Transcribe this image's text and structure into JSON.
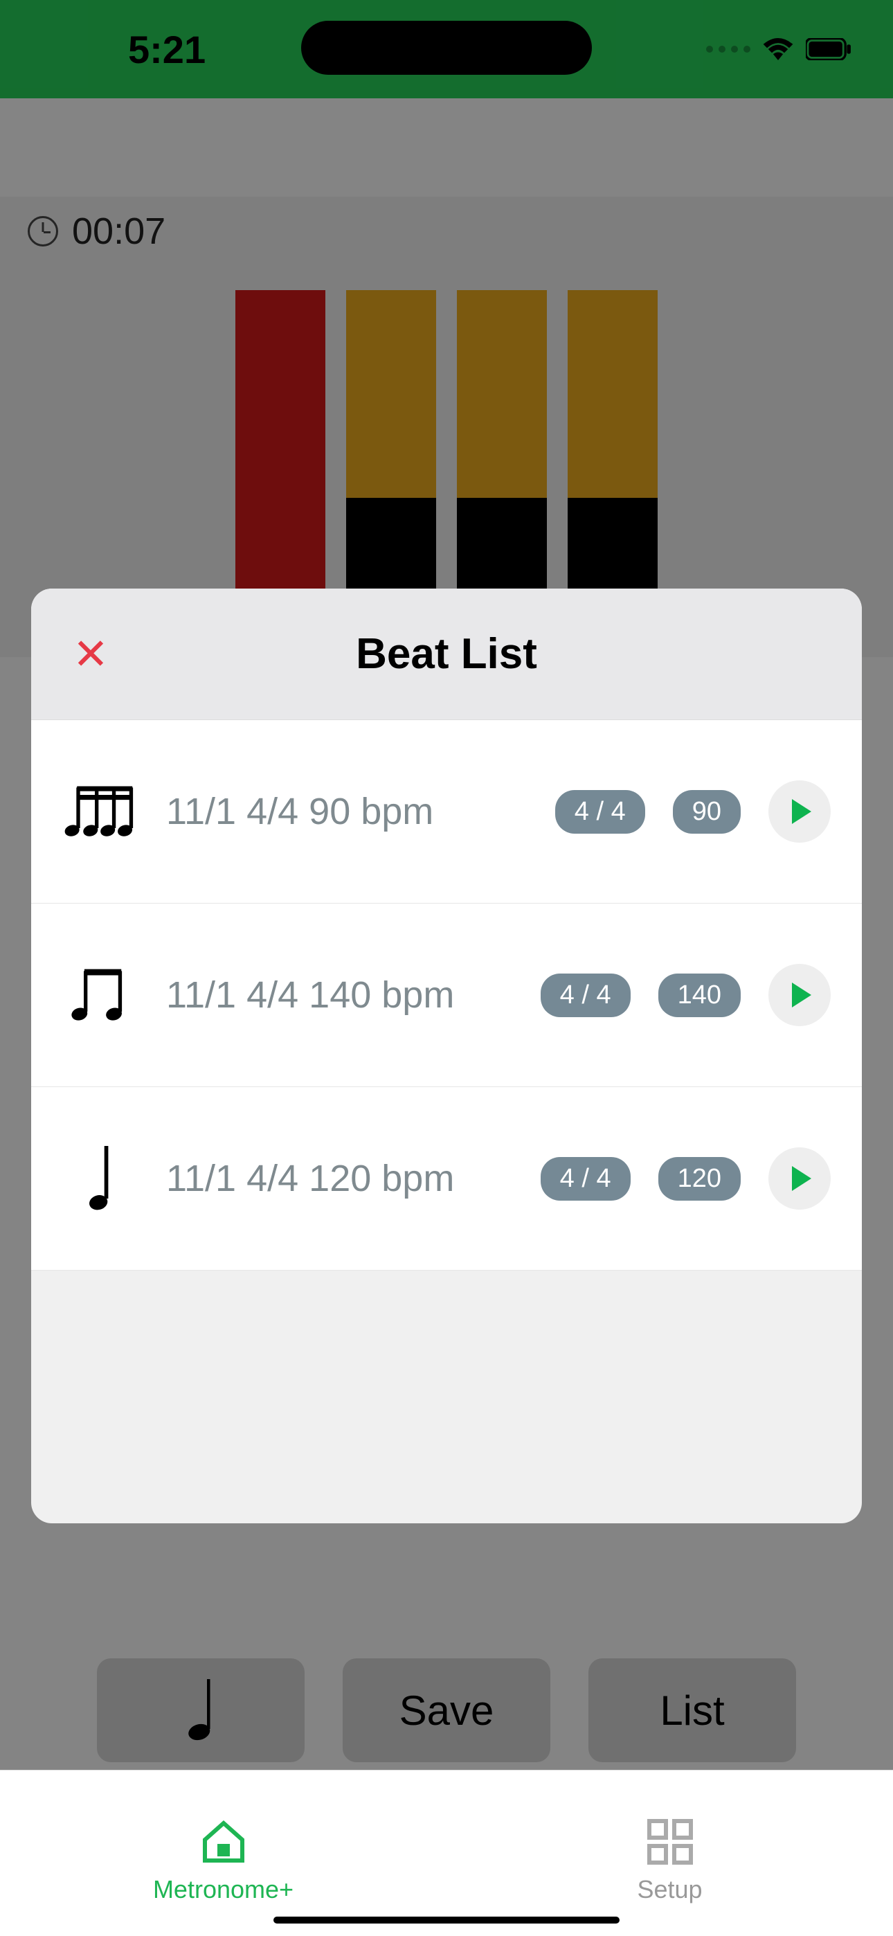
{
  "status": {
    "time": "5:21"
  },
  "timer": {
    "elapsed": "00:07"
  },
  "modal": {
    "title": "Beat List",
    "items": [
      {
        "label": "11/1 4/4 90 bpm",
        "signature": "4 / 4",
        "bpm": "90",
        "note_icon": "sixteenth-notes"
      },
      {
        "label": "11/1 4/4 140 bpm",
        "signature": "4 / 4",
        "bpm": "140",
        "note_icon": "eighth-notes"
      },
      {
        "label": "11/1 4/4 120 bpm",
        "signature": "4 / 4",
        "bpm": "120",
        "note_icon": "quarter-note"
      }
    ]
  },
  "buttons": {
    "save": "Save",
    "list": "List"
  },
  "tabs": {
    "metronome": "Metronome+",
    "setup": "Setup"
  }
}
